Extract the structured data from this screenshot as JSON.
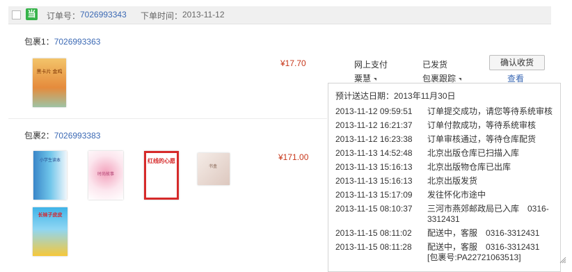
{
  "order": {
    "logo_char": "当",
    "no_label": "订单号：",
    "no_value": "7026993343",
    "time_label": "下单时间：",
    "time_value": "2013-11-12"
  },
  "packages": [
    {
      "label": "包裹1：",
      "id": "7026993363",
      "price": "¥17.70",
      "books": [
        {
          "title": "黑卡片 金鸡",
          "color": "#e9a35a"
        }
      ]
    },
    {
      "label": "包裹2：",
      "id": "7026993383",
      "price": "¥171.00",
      "books": [
        {
          "title": "小学生读本",
          "color": "#4aa3d9"
        },
        {
          "title": "时尚故事",
          "color": "#e88aa7"
        },
        {
          "title": "红线的心愿",
          "color": "#d62a2a"
        },
        {
          "title": "书盒",
          "color": "#e8d9d3"
        },
        {
          "title": "长袜子皮皮",
          "color": "#3fb3e8"
        }
      ]
    }
  ],
  "payment": {
    "method": "网上支付",
    "status": "已发货",
    "confirm_label": "确认收货",
    "recipient": "粟慧",
    "tracking_label": "包裹跟踪",
    "view_label": "查看"
  },
  "tracking": {
    "eta": "预计送达日期：2013年11月30日",
    "events": [
      {
        "time": "2013-11-12 09:59:51",
        "desc": "订单提交成功，请您等待系统审核"
      },
      {
        "time": "2013-11-12 16:21:37",
        "desc": "订单付款成功，等待系统审核"
      },
      {
        "time": "2013-11-12 16:23:38",
        "desc": "订单审核通过，等待仓库配货"
      },
      {
        "time": "2013-11-13 14:52:48",
        "desc": "北京出版仓库已扫描入库"
      },
      {
        "time": "2013-11-13 15:16:13",
        "desc": "北京出版物仓库已出库"
      },
      {
        "time": "2013-11-13 15:16:13",
        "desc": "北京出版发货"
      },
      {
        "time": "2013-11-13 15:17:09",
        "desc": "发往怀化市途中"
      },
      {
        "time": "2013-11-15 08:10:37",
        "desc": "三河市燕郊邮政局已入库　0316-3312431"
      },
      {
        "time": "2013-11-15 08:11:02",
        "desc": "配送中，客服　0316-3312431"
      },
      {
        "time": "2013-11-15 08:11:28",
        "desc": "配送中，客服　0316-3312431 [包裹号:PA22721063513]"
      }
    ]
  }
}
